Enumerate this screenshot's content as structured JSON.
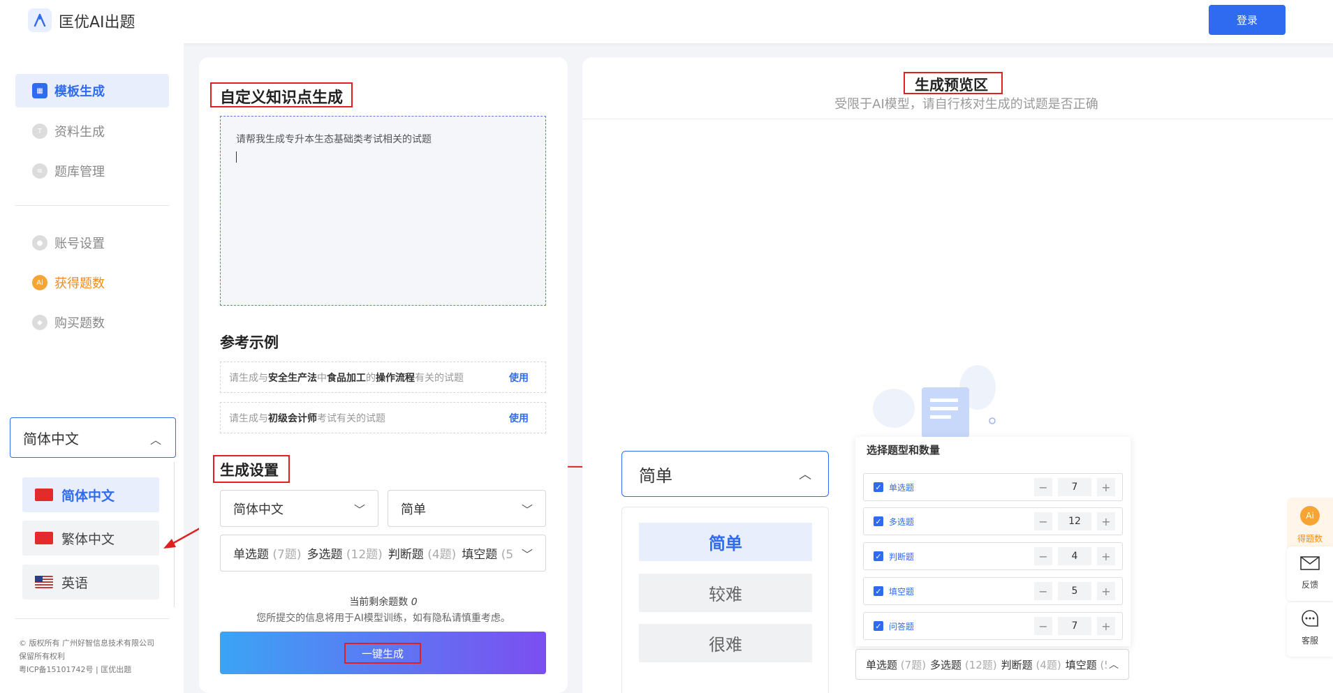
{
  "header": {
    "app_title": "匡优AI出题",
    "login_label": "登录"
  },
  "sidebar": {
    "items": [
      {
        "label": "模板生成"
      },
      {
        "label": "资料生成"
      },
      {
        "label": "题库管理"
      },
      {
        "label": "账号设置"
      },
      {
        "label": "获得题数"
      },
      {
        "label": "购买题数"
      }
    ],
    "language": {
      "selected": "简体中文",
      "options": [
        "简体中文",
        "繁体中文",
        "英语"
      ]
    },
    "footer": [
      "© 版权所有 广州好智信息技术有限公司",
      "保留所有权利",
      "粤ICP备15101742号 | 匡优出题"
    ]
  },
  "left_panel": {
    "custom_title": "自定义知识点生成",
    "prompt_text": "请帮我生成专升本生态基础类考试相关的试题",
    "examples_title": "参考示例",
    "examples": [
      {
        "p1": "请生成与",
        "b1": "安全生产法",
        "p2": "中",
        "b2": "食品加工",
        "p3": "的",
        "b3": "操作流程",
        "p4": "有关的试题",
        "use": "使用"
      },
      {
        "p1": "请生成与",
        "b1": "初级会计师",
        "p2": "考试有关的试题",
        "use": "使用"
      }
    ],
    "settings_title": "生成设置",
    "language_select": "简体中文",
    "difficulty_select": "简单",
    "types_summary": [
      {
        "name": "单选题",
        "count": "(7题)"
      },
      {
        "name": "多选题",
        "count": "(12题)"
      },
      {
        "name": "判断题",
        "count": "(4题)"
      },
      {
        "name": "填空题",
        "count": "(5"
      }
    ],
    "remain_label": "当前剩余题数",
    "remain_value": "0",
    "notice": "您所提交的信息将用于AI模型训练，如有隐私请慎重考虑。",
    "generate_label": "一键生成"
  },
  "right_panel": {
    "preview_title": "生成预览区",
    "preview_subtitle": "受限于AI模型，请自行核对生成的试题是否正确",
    "difficulty": {
      "selected": "简单",
      "options": [
        "简单",
        "较难",
        "很难"
      ]
    },
    "qtype_title": "选择题型和数量",
    "qtypes": [
      {
        "name": "单选题",
        "value": "7"
      },
      {
        "name": "多选题",
        "value": "12"
      },
      {
        "name": "判断题",
        "value": "4"
      },
      {
        "name": "填空题",
        "value": "5"
      },
      {
        "name": "问答题",
        "value": "7"
      }
    ],
    "qtype_summary": [
      {
        "name": "单选题",
        "count": "(7题)"
      },
      {
        "name": "多选题",
        "count": "(12题)"
      },
      {
        "name": "判断题",
        "count": "(4题)"
      },
      {
        "name": "填空题",
        "count": "(5"
      }
    ]
  },
  "floating": {
    "ai_badge": "Ai",
    "ai_label": "得题数",
    "feedback_label": "反馈",
    "service_label": "客服"
  },
  "colors": {
    "accent": "#2f6bf1",
    "annotation": "#e02020",
    "orange": "#f28c1d"
  }
}
